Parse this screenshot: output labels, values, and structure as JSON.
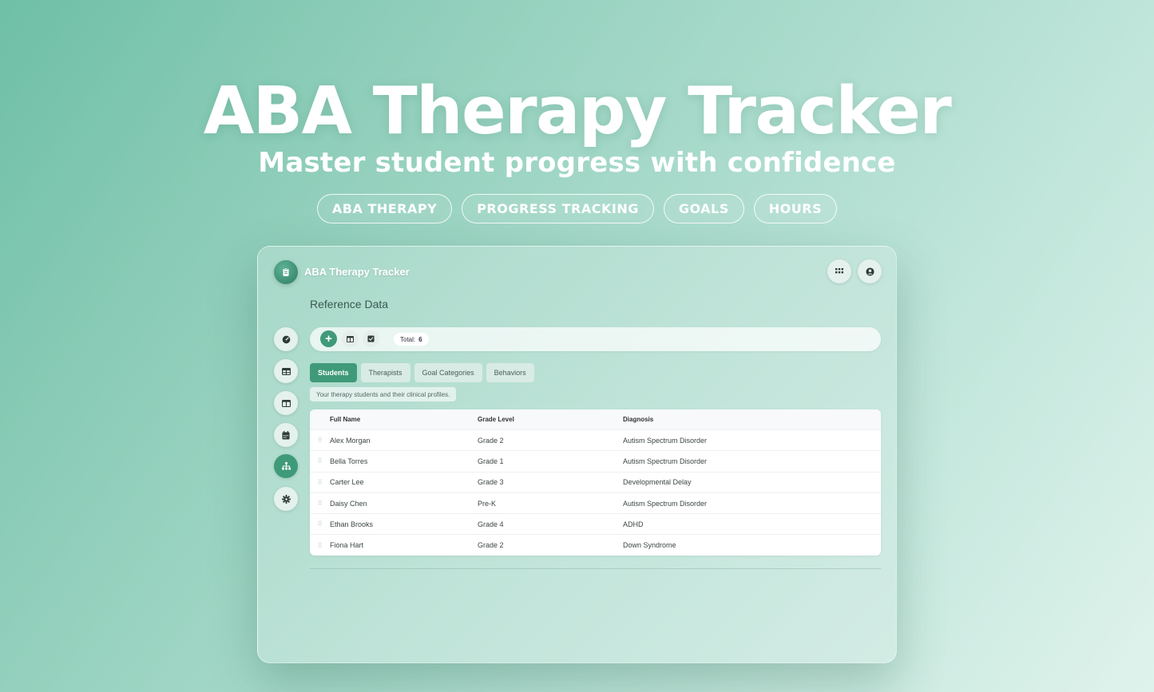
{
  "hero": {
    "title": "ABA Therapy Tracker",
    "subtitle": "Master student progress with confidence",
    "pills": [
      "ABA THERAPY",
      "PROGRESS TRACKING",
      "GOALS",
      "HOURS"
    ]
  },
  "app": {
    "title": "ABA Therapy Tracker",
    "logo_icon": "clipboard-icon",
    "header_actions": [
      "apps-grid-icon",
      "account-circle-icon"
    ]
  },
  "page": {
    "title": "Reference Data"
  },
  "sidebar": {
    "items": [
      {
        "icon": "dashboard-icon",
        "active": false
      },
      {
        "icon": "table-icon",
        "active": false
      },
      {
        "icon": "board-icon",
        "active": false
      },
      {
        "icon": "calendar-icon",
        "active": false
      },
      {
        "icon": "hierarchy-icon",
        "active": true
      },
      {
        "icon": "gear-icon",
        "active": false
      }
    ]
  },
  "toolbar": {
    "add_label": "+",
    "total_label": "Total:",
    "total_value": "6"
  },
  "tabs": [
    {
      "label": "Students",
      "active": true
    },
    {
      "label": "Therapists",
      "active": false
    },
    {
      "label": "Goal Categories",
      "active": false
    },
    {
      "label": "Behaviors",
      "active": false
    }
  ],
  "hint": "Your therapy students and their clinical profiles.",
  "table": {
    "columns": [
      "Full Name",
      "Grade Level",
      "Diagnosis"
    ],
    "handle": "⠿",
    "rows": [
      [
        "Alex Morgan",
        "Grade 2",
        "Autism Spectrum Disorder"
      ],
      [
        "Bella Torres",
        "Grade 1",
        "Autism Spectrum Disorder"
      ],
      [
        "Carter Lee",
        "Grade 3",
        "Developmental Delay"
      ],
      [
        "Daisy Chen",
        "Pre-K",
        "Autism Spectrum Disorder"
      ],
      [
        "Ethan Brooks",
        "Grade 4",
        "ADHD"
      ],
      [
        "Fiona Hart",
        "Grade 2",
        "Down Syndrome"
      ]
    ]
  },
  "colors": {
    "accent": "#3f9a7a",
    "background_start": "#6fbfa6",
    "background_end": "#dff3ec"
  }
}
